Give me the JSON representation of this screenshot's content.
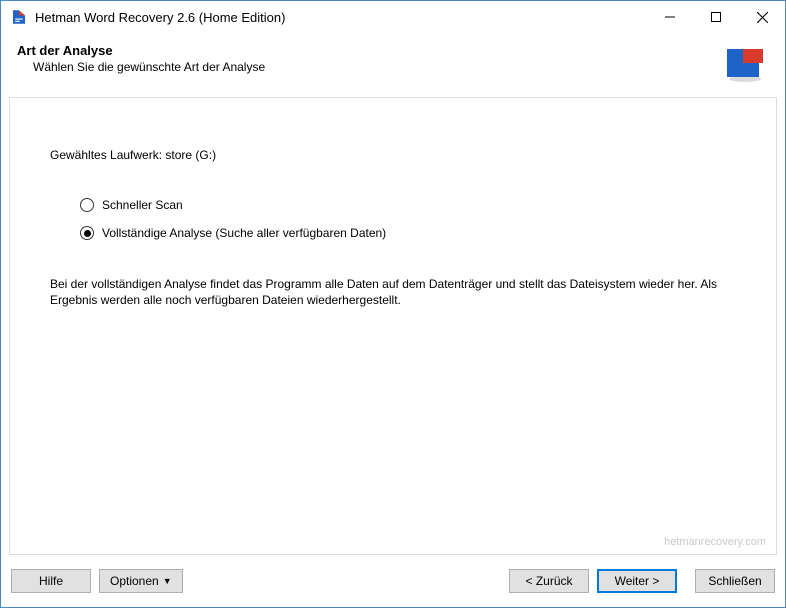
{
  "window": {
    "title": "Hetman Word Recovery 2.6 (Home Edition)"
  },
  "header": {
    "heading": "Art der Analyse",
    "subheading": "Wählen Sie die gewünschte Art der Analyse"
  },
  "content": {
    "drive_label_prefix": "Gewähltes Laufwerk: ",
    "drive_value": "store (G:)",
    "options": {
      "quick": {
        "label": "Schneller Scan",
        "checked": false
      },
      "full": {
        "label": "Vollständige Analyse (Suche aller verfügbaren Daten)",
        "checked": true
      }
    },
    "description": "Bei der vollständigen Analyse findet das Programm alle Daten auf dem Datenträger und stellt das Dateisystem wieder her. Als Ergebnis werden alle noch verfügbaren Dateien wiederhergestellt."
  },
  "watermark": "hetmanrecovery.com",
  "buttons": {
    "help": "Hilfe",
    "options": "Optionen",
    "back": "<  Zurück",
    "next": "Weiter  >",
    "close": "Schließen"
  }
}
